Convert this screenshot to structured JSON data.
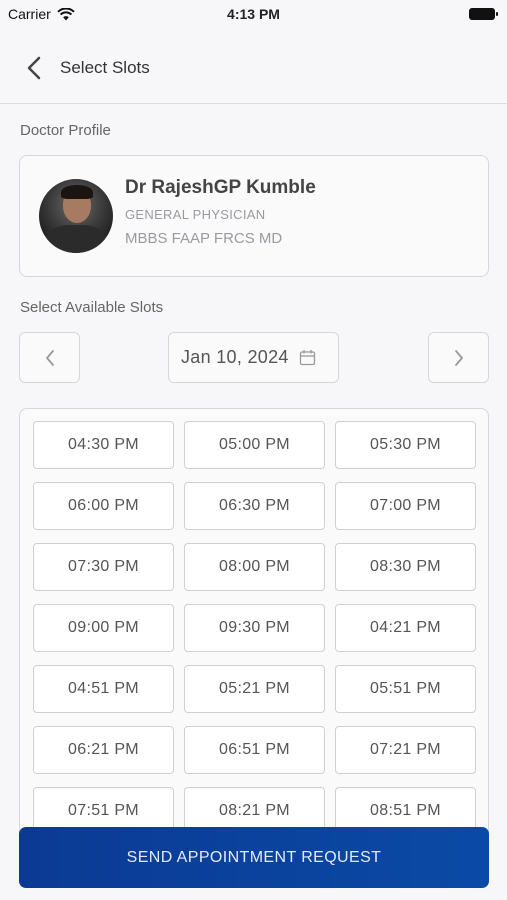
{
  "status_bar": {
    "carrier": "Carrier",
    "time": "4:13 PM"
  },
  "header": {
    "title": "Select Slots"
  },
  "profile": {
    "section_label": "Doctor Profile",
    "name": "Dr RajeshGP Kumble",
    "specialty": "GENERAL PHYSICIAN",
    "qualifications": "MBBS FAAP FRCS MD"
  },
  "slots_section": {
    "label": "Select Available Slots",
    "date": "Jan 10, 2024"
  },
  "slots": [
    "04:30 PM",
    "05:00 PM",
    "05:30 PM",
    "06:00 PM",
    "06:30 PM",
    "07:00 PM",
    "07:30 PM",
    "08:00 PM",
    "08:30 PM",
    "09:00 PM",
    "09:30 PM",
    "04:21 PM",
    "04:51 PM",
    "05:21 PM",
    "05:51 PM",
    "06:21 PM",
    "06:51 PM",
    "07:21 PM",
    "07:51 PM",
    "08:21 PM",
    "08:51 PM"
  ],
  "send_button": {
    "label": "SEND APPOINTMENT REQUEST"
  },
  "colors": {
    "primary": "#0b3a94",
    "border": "#d7d7db",
    "background": "#f7f7f9"
  }
}
